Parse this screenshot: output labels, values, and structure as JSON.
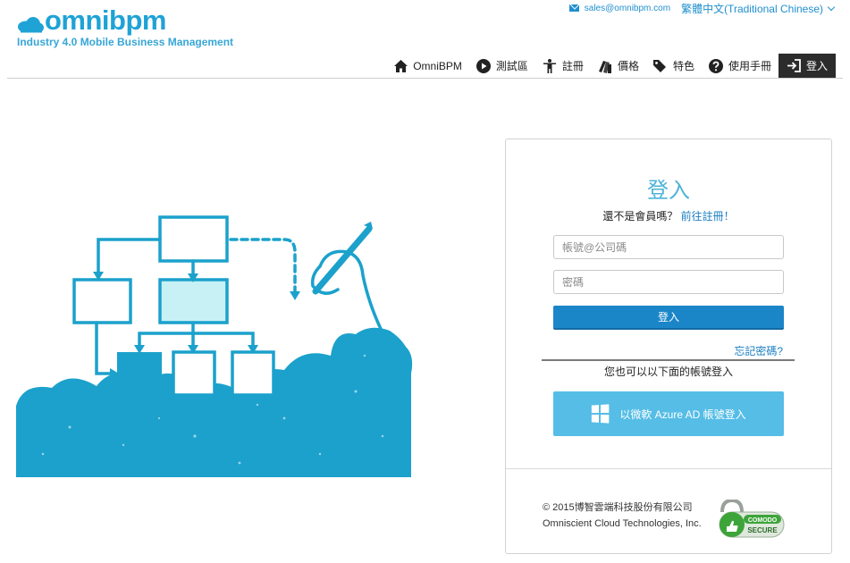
{
  "header": {
    "logo_text": "omnibpm",
    "tagline": "Industry 4.0 Mobile Business Management",
    "email": "sales@omnibpm.com",
    "language": "繁體中文(Traditional Chinese)"
  },
  "nav": {
    "items": [
      {
        "label": "OmniBPM",
        "icon": "home-icon"
      },
      {
        "label": "測試區",
        "icon": "play-circle-icon"
      },
      {
        "label": "註冊",
        "icon": "person-icon"
      },
      {
        "label": "價格",
        "icon": "books-icon"
      },
      {
        "label": "特色",
        "icon": "tags-icon"
      },
      {
        "label": "使用手冊",
        "icon": "question-circle-icon"
      },
      {
        "label": "登入",
        "icon": "sign-in-icon"
      }
    ]
  },
  "login": {
    "title": "登入",
    "not_member": "還不是會員嗎？",
    "register_link": "前往註冊！",
    "username_placeholder": "帳號@公司碼",
    "password_placeholder": "密碼",
    "login_button": "登入",
    "forgot": "忘記密碼?",
    "alt_login_text": "您也可以以下面的帳號登入",
    "azure_button": "以微軟 Azure AD 帳號登入"
  },
  "footer": {
    "copyright_line1": "© 2015博智雲端科技股份有限公司",
    "copyright_line2": "Omniscient Cloud Technologies, Inc.",
    "badge_top": "COMODO",
    "badge_bottom": "SECURE"
  },
  "colors": {
    "brand": "#1fa3d6",
    "illustration": "#1ba1cc",
    "login_button": "#1a86c8",
    "azure_button": "#55bde6",
    "nav_active": "#2c2c2c"
  }
}
